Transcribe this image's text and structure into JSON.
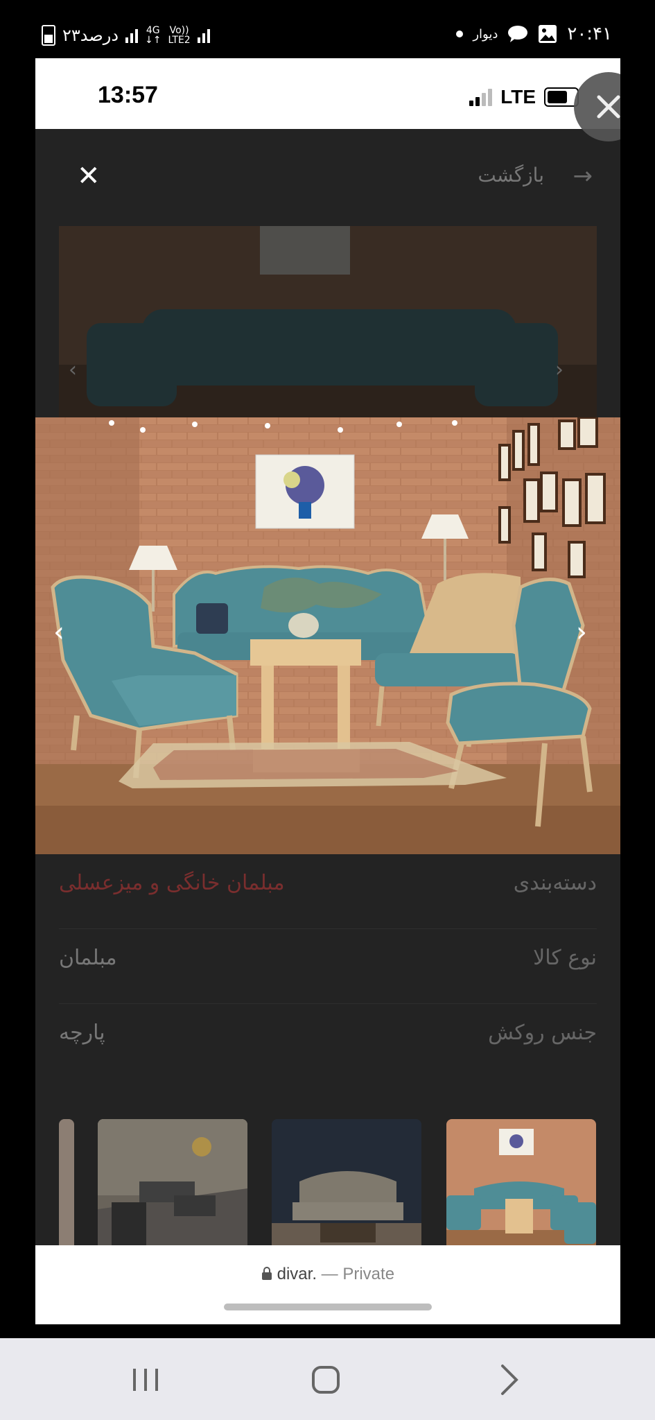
{
  "outer_status": {
    "time": "۲۰:۴۱",
    "app_label": "دیوار",
    "battery_text": "۲۳درصد",
    "net_label_1": "4G",
    "net_label_2": "Vo))",
    "net_label_3": "LTE2"
  },
  "inner_status": {
    "time": "13:57",
    "network": "LTE"
  },
  "header": {
    "back_label": "بازگشت"
  },
  "details": [
    {
      "label": "دسته‌بندی",
      "value": "مبلمان خانگی و میزعسلی"
    },
    {
      "label": "نوع کالا",
      "value": "مبلمان"
    },
    {
      "label": "جنس روکش",
      "value": "پارچه"
    }
  ],
  "url_bar": {
    "url": "divar.",
    "suffix": "— Private"
  },
  "colors": {
    "accent": "#7a2e2e",
    "sofa_teal": "#4f8d96",
    "brick": "#b77d5c"
  },
  "icons": [
    "close-icon",
    "back-arrow-icon",
    "chevron-left-icon",
    "chevron-right-icon",
    "lock-icon",
    "recents-icon",
    "home-icon",
    "back-nav-icon"
  ]
}
